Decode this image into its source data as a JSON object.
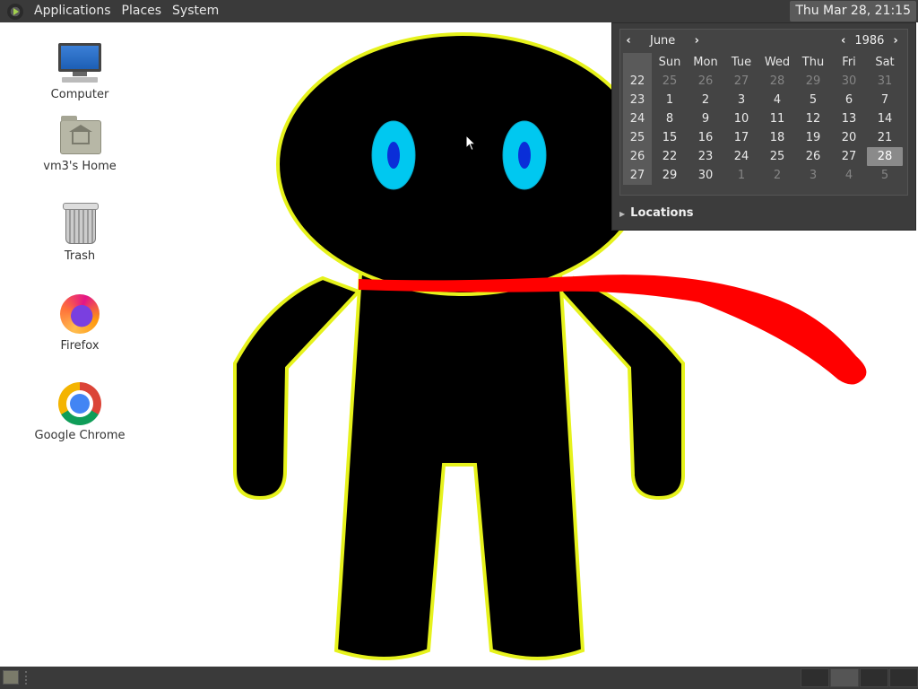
{
  "top_panel": {
    "menus": [
      "Applications",
      "Places",
      "System"
    ],
    "clock": "Thu Mar 28, 21:15"
  },
  "desktop_icons": [
    {
      "label": "Computer",
      "icon": "computer-icon"
    },
    {
      "label": "vm3's Home",
      "icon": "home-folder-icon"
    },
    {
      "label": "Trash",
      "icon": "trash-icon"
    },
    {
      "label": "Firefox",
      "icon": "firefox-icon"
    },
    {
      "label": "Google Chrome",
      "icon": "chrome-icon"
    }
  ],
  "drawing": {
    "colors": {
      "body": "#000000",
      "outline": "#e6f21c",
      "eye_outer": "#00c8f0",
      "pupil": "#0a2ed8",
      "scarf": "#ff0000"
    }
  },
  "calendar": {
    "month": "June",
    "year": "1986",
    "weekdays": [
      "Sun",
      "Mon",
      "Tue",
      "Wed",
      "Thu",
      "Fri",
      "Sat"
    ],
    "weeks": [
      {
        "week": "22",
        "days": [
          "25",
          "26",
          "27",
          "28",
          "29",
          "30",
          "31"
        ],
        "other": [
          true,
          true,
          true,
          true,
          true,
          true,
          true
        ]
      },
      {
        "week": "23",
        "days": [
          "1",
          "2",
          "3",
          "4",
          "5",
          "6",
          "7"
        ],
        "other": [
          false,
          false,
          false,
          false,
          false,
          false,
          false
        ]
      },
      {
        "week": "24",
        "days": [
          "8",
          "9",
          "10",
          "11",
          "12",
          "13",
          "14"
        ],
        "other": [
          false,
          false,
          false,
          false,
          false,
          false,
          false
        ]
      },
      {
        "week": "25",
        "days": [
          "15",
          "16",
          "17",
          "18",
          "19",
          "20",
          "21"
        ],
        "other": [
          false,
          false,
          false,
          false,
          false,
          false,
          false
        ]
      },
      {
        "week": "26",
        "days": [
          "22",
          "23",
          "24",
          "25",
          "26",
          "27",
          "28"
        ],
        "other": [
          false,
          false,
          false,
          false,
          false,
          false,
          false
        ]
      },
      {
        "week": "27",
        "days": [
          "29",
          "30",
          "1",
          "2",
          "3",
          "4",
          "5"
        ],
        "other": [
          false,
          false,
          true,
          true,
          true,
          true,
          true
        ]
      }
    ],
    "selected_day": "28",
    "locations_label": "Locations"
  }
}
